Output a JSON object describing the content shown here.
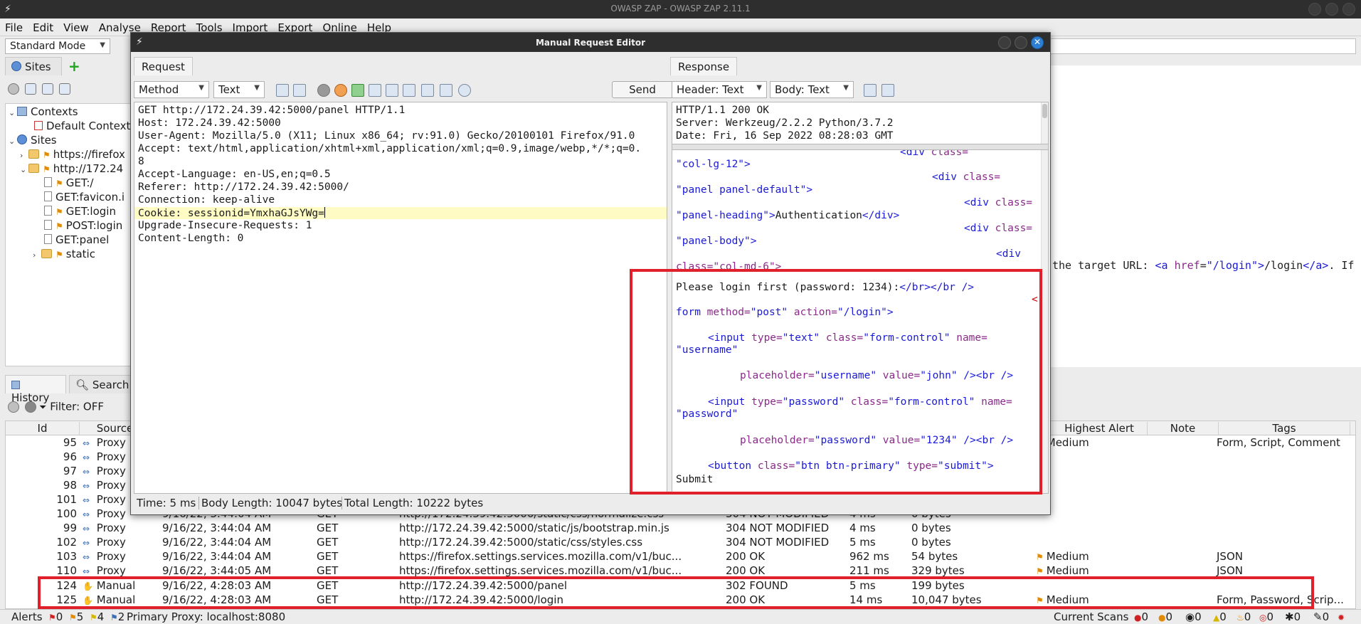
{
  "window": {
    "title": "OWASP ZAP - OWASP ZAP 2.11.1"
  },
  "menu": [
    "File",
    "Edit",
    "View",
    "Analyse",
    "Report",
    "Tools",
    "Import",
    "Export",
    "Online",
    "Help"
  ],
  "mode": {
    "selected": "Standard Mode"
  },
  "sites": {
    "tab_label": "Sites",
    "tree": [
      {
        "label": "Contexts"
      },
      {
        "label": "Default Context"
      },
      {
        "label": "Sites"
      },
      {
        "label": "https://firefox"
      },
      {
        "label": "http://172.24"
      },
      {
        "label": "GET:/"
      },
      {
        "label": "GET:favicon.i"
      },
      {
        "label": "GET:login"
      },
      {
        "label": "POST:login"
      },
      {
        "label": "GET:panel"
      },
      {
        "label": "static"
      }
    ]
  },
  "output": {
    "text_prefix": "the target URL: ",
    "tag_open": "<a ",
    "attr": "href",
    "eq": "=",
    "value": "\"/login\"",
    "close": ">",
    "link": "/login",
    "end_tag": "</a>",
    "tail": ". If"
  },
  "history": {
    "tab_history": "History",
    "tab_search": "Search",
    "filter": "Filter: OFF",
    "columns": {
      "id": "Id",
      "source": "Source",
      "highest_alert": "Highest Alert",
      "note": "Note",
      "tags": "Tags"
    },
    "rows": [
      {
        "id": "95",
        "source": "Proxy",
        "alert": "Medium",
        "tags": "Form, Script, Comment"
      },
      {
        "id": "96",
        "source": "Proxy"
      },
      {
        "id": "97",
        "source": "Proxy"
      },
      {
        "id": "98",
        "source": "Proxy"
      },
      {
        "id": "101",
        "source": "Proxy"
      },
      {
        "id": "100",
        "source": "Proxy",
        "time": "9/16/22, 3:44:04 AM",
        "method": "GET",
        "url": "http://172.24.39.42:5000/static/css/normalize.css",
        "code": "304 NOT MODIFIED",
        "rtt": "4 ms",
        "size": "0 bytes"
      },
      {
        "id": "99",
        "source": "Proxy",
        "time": "9/16/22, 3:44:04 AM",
        "method": "GET",
        "url": "http://172.24.39.42:5000/static/js/bootstrap.min.js",
        "code": "304 NOT MODIFIED",
        "rtt": "4 ms",
        "size": "0 bytes"
      },
      {
        "id": "102",
        "source": "Proxy",
        "time": "9/16/22, 3:44:04 AM",
        "method": "GET",
        "url": "http://172.24.39.42:5000/static/css/styles.css",
        "code": "304 NOT MODIFIED",
        "rtt": "5 ms",
        "size": "0 bytes"
      },
      {
        "id": "103",
        "source": "Proxy",
        "time": "9/16/22, 3:44:04 AM",
        "method": "GET",
        "url": "https://firefox.settings.services.mozilla.com/v1/buc...",
        "code": "200 OK",
        "rtt": "962 ms",
        "size": "54 bytes",
        "alert": "Medium",
        "tags": "JSON"
      },
      {
        "id": "110",
        "source": "Proxy",
        "time": "9/16/22, 3:44:05 AM",
        "method": "GET",
        "url": "https://firefox.settings.services.mozilla.com/v1/buc...",
        "code": "200 OK",
        "rtt": "211 ms",
        "size": "329 bytes",
        "alert": "Medium",
        "tags": "JSON"
      },
      {
        "id": "124",
        "source": "Manual",
        "time": "9/16/22, 4:28:03 AM",
        "method": "GET",
        "url": "http://172.24.39.42:5000/panel",
        "code": "302 FOUND",
        "rtt": "5 ms",
        "size": "199 bytes"
      },
      {
        "id": "125",
        "source": "Manual",
        "time": "9/16/22, 4:28:03 AM",
        "method": "GET",
        "url": "http://172.24.39.42:5000/login",
        "code": "200 OK",
        "rtt": "14 ms",
        "size": "10,047 bytes",
        "alert": "Medium",
        "tags": "Form, Password, Scrip..."
      }
    ]
  },
  "statusbar": {
    "alerts": "Alerts",
    "high": "0",
    "medium": "5",
    "low": "4",
    "info": "2",
    "proxy": "Primary Proxy: localhost:8080",
    "current_scans": "Current Scans",
    "scan_counts": [
      "0",
      "0",
      "0",
      "0",
      "0",
      "0",
      "0",
      "0"
    ]
  },
  "dialog": {
    "title": "Manual Request Editor",
    "request_tab": "Request",
    "response_tab": "Response",
    "method_combo": "Method",
    "text_combo": "Text",
    "send": "Send",
    "header_combo": "Header: Text",
    "body_combo": "Body: Text",
    "request_lines": [
      "GET http://172.24.39.42:5000/panel HTTP/1.1",
      "Host: 172.24.39.42:5000",
      "User-Agent: Mozilla/5.0 (X11; Linux x86_64; rv:91.0) Gecko/20100101 Firefox/91.0",
      "Accept: text/html,application/xhtml+xml,application/xml;q=0.9,image/webp,*/*;q=0.",
      "8",
      "Accept-Language: en-US,en;q=0.5",
      "Referer: http://172.24.39.42:5000/",
      "Connection: keep-alive",
      "Cookie: sessionid=YmxhaGJsYWg=",
      "Upgrade-Insecure-Requests: 1",
      "Content-Length: 0"
    ],
    "response_header_lines": [
      "HTTP/1.1 200 OK",
      "Server: Werkzeug/2.2.2 Python/3.7.2",
      "Date: Fri, 16 Sep 2022 08:28:03 GMT"
    ],
    "response_body": {
      "div1_tag": "<div ",
      "div1_attr": "class=",
      "val1": "\"col-lg-12\"",
      "gt": ">",
      "div2_tag": "<div ",
      "div2_attr": "class=",
      "val2": "\"panel panel-default\"",
      "div3_tag": "<div ",
      "div3_attr": "class=",
      "val3": "\"panel-heading\"",
      "heading_text": "Authentication",
      "div3_close": "</div>",
      "div4_tag": "<div ",
      "div4_attr": "class=",
      "val4": "\"panel-body\"",
      "div5_tag": "<div",
      "val5": "class=\"col-md-6\">",
      "login_text": "Please login first (password: 1234):",
      "br_tags": "</br></br />",
      "lt": "<",
      "form_tag": "form ",
      "form_a1": "method=",
      "form_v1": "\"post\"",
      "form_a2": " action=",
      "form_v2": "\"/login\"",
      "in1_tag": "<input ",
      "in1_a1": "type=",
      "in1_v1": "\"text\"",
      "in1_a2": " class=",
      "in1_v2": "\"form-control\"",
      "in1_a3": " name=",
      "in1_v3": "\"username\"",
      "in1_a4": "placeholder=",
      "in1_v4": "\"username\"",
      "in1_a5": " value=",
      "in1_v5": "\"john\"",
      "in1_end": " /><br />",
      "in2_tag": "<input ",
      "in2_a1": "type=",
      "in2_v1": "\"password\"",
      "in2_a2": " class=",
      "in2_v2": "\"form-control\"",
      "in2_a3": " name=",
      "in2_v3": "\"password\"",
      "in2_a4": "placeholder=",
      "in2_v4": "\"password\"",
      "in2_a5": " value=",
      "in2_v5": "\"1234\"",
      "in2_end": " /><br />",
      "btn_tag": "<button ",
      "btn_a1": "class=",
      "btn_v1": "\"btn btn-primary\"",
      "btn_a2": " type=",
      "btn_v2": "\"submit\"",
      "btn_end": ">",
      "submit_text": "Submit"
    },
    "status": {
      "time": "Time: 5 ms",
      "body_length": "Body Length: 10047 bytes",
      "total_length": "Total Length: 10222 bytes"
    }
  },
  "colors": {
    "highlight_box": "#e0202a",
    "cookie_highlight": "#fefcc4"
  }
}
